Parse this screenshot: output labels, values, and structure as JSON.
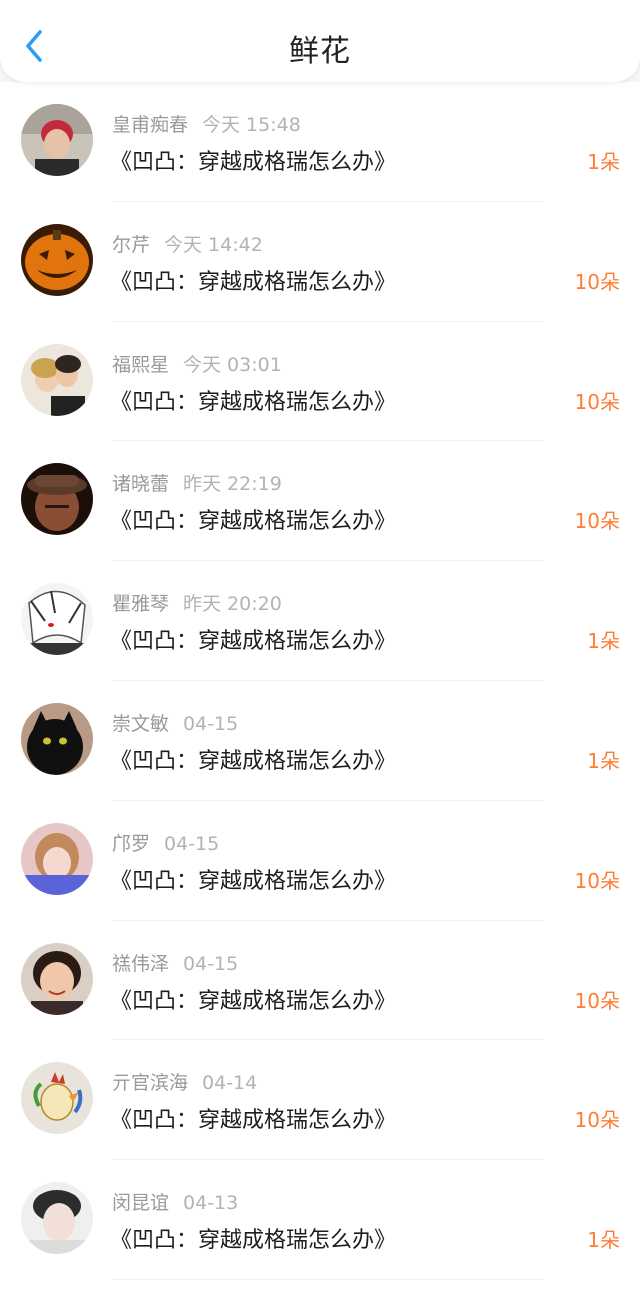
{
  "header": {
    "title": "鲜花",
    "back_icon": "chevron-left-icon",
    "accent_color": "#2a9df4"
  },
  "flower_color": "#ff7d35",
  "rows": [
    {
      "user": "皇甫痴春",
      "time": "今天 15:48",
      "book": "《凹凸：穿越成格瑞怎么办》",
      "count": "1朵",
      "avatar": "avatar-photo-red-hair"
    },
    {
      "user": "尔芹",
      "time": "今天 14:42",
      "book": "《凹凸：穿越成格瑞怎么办》",
      "count": "10朵",
      "avatar": "avatar-pumpkin"
    },
    {
      "user": "福熙星",
      "time": "今天 03:01",
      "book": "《凹凸：穿越成格瑞怎么办》",
      "count": "10朵",
      "avatar": "avatar-couple"
    },
    {
      "user": "诸晓蕾",
      "time": "昨天 22:19",
      "book": "《凹凸：穿越成格瑞怎么办》",
      "count": "10朵",
      "avatar": "avatar-soldier"
    },
    {
      "user": "瞿雅琴",
      "time": "昨天 20:20",
      "book": "《凹凸：穿越成格瑞怎么办》",
      "count": "1朵",
      "avatar": "avatar-anime-sketch"
    },
    {
      "user": "崇文敏",
      "time": "04-15",
      "book": "《凹凸：穿越成格瑞怎么办》",
      "count": "1朵",
      "avatar": "avatar-black-cat"
    },
    {
      "user": "邝罗",
      "time": "04-15",
      "book": "《凹凸：穿越成格瑞怎么办》",
      "count": "10朵",
      "avatar": "avatar-girl-pink"
    },
    {
      "user": "禚伟泽",
      "time": "04-15",
      "book": "《凹凸：穿越成格瑞怎么办》",
      "count": "10朵",
      "avatar": "avatar-child"
    },
    {
      "user": "亓官滨海",
      "time": "04-14",
      "book": "《凹凸：穿越成格瑞怎么办》",
      "count": "10朵",
      "avatar": "avatar-rooster-drawing"
    },
    {
      "user": "闵昆谊",
      "time": "04-13",
      "book": "《凹凸：穿越成格瑞怎么办》",
      "count": "1朵",
      "avatar": "avatar-man-portrait"
    }
  ]
}
